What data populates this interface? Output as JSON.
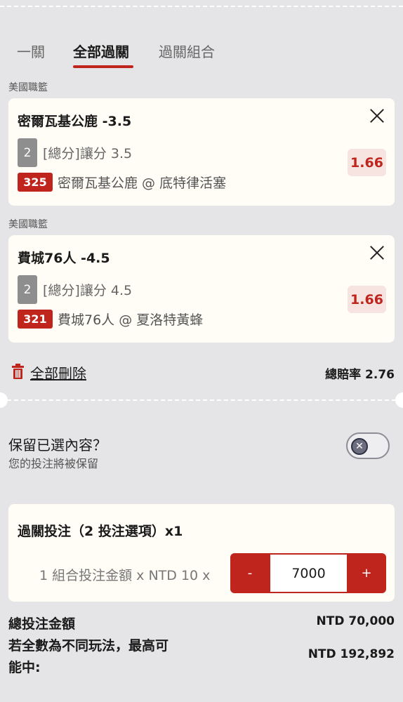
{
  "tabs": [
    {
      "label": "一關"
    },
    {
      "label": "全部過關"
    },
    {
      "label": "過關組合"
    }
  ],
  "active_tab": "全部過關",
  "bets": [
    {
      "league": "美國職籃",
      "title": "密爾瓦基公鹿 -3.5",
      "leg_number": "2",
      "market": "[總分]讓分 3.5",
      "code": "325",
      "match": "密爾瓦基公鹿 @ 底特律活塞",
      "odds": "1.66"
    },
    {
      "league": "美國職籃",
      "title": "費城76人 -4.5",
      "leg_number": "2",
      "market": "[總分]讓分 4.5",
      "code": "321",
      "match": "費城76人 @ 夏洛特黃蜂",
      "odds": "1.66"
    }
  ],
  "delete_all_label": "全部刪除",
  "total_odds_label": "總賠率 2.76",
  "keep_selection": {
    "title": "保留已選內容？",
    "subtitle": "您的投注將被保留",
    "toggle_on": false
  },
  "parlay": {
    "title": "過關投注（2 投注選項）x1",
    "stake_label": "1 組合投注金額 x NTD 10 x",
    "minus": "-",
    "plus": "+",
    "stake_value": "7000"
  },
  "summary": {
    "total_label": "總投注金額",
    "total_value": "NTD 70,000",
    "max_win_label_line1": "若全數為不同玩法，最高可",
    "max_win_label_line2": "能中:",
    "max_win_value": "NTD 192,892"
  },
  "colors": {
    "accent": "#c0251d",
    "background": "#e5e5e7",
    "card": "#fffdf6",
    "odds_bg": "#f7e3e0"
  }
}
